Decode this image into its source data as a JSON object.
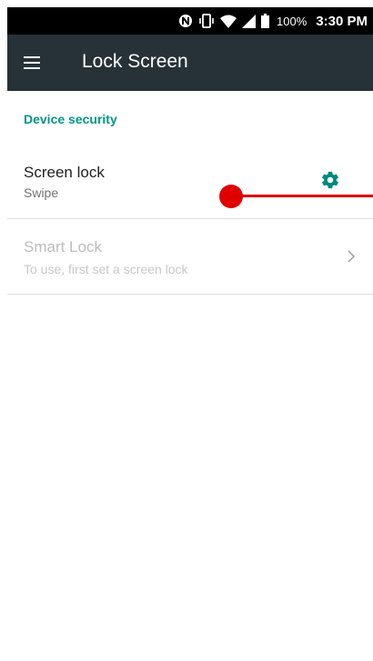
{
  "status_bar": {
    "battery_percent": "100%",
    "time": "3:30 PM",
    "icons": [
      "nfc-icon",
      "vibrate-icon",
      "wifi-icon",
      "signal-icon",
      "battery-icon"
    ]
  },
  "toolbar": {
    "menu_icon": "menu-icon",
    "title": "Lock Screen",
    "background_color": "#263238"
  },
  "section": {
    "header": "Device security",
    "accent_color": "#009688"
  },
  "preferences": [
    {
      "title": "Screen lock",
      "summary": "Swipe",
      "enabled": true,
      "action_icon": "gear-icon"
    },
    {
      "title": "Smart Lock",
      "summary": "To use, first set a screen lock",
      "enabled": false,
      "action_icon": "chevron-right-icon"
    }
  ],
  "annotation_color": "#e00000"
}
